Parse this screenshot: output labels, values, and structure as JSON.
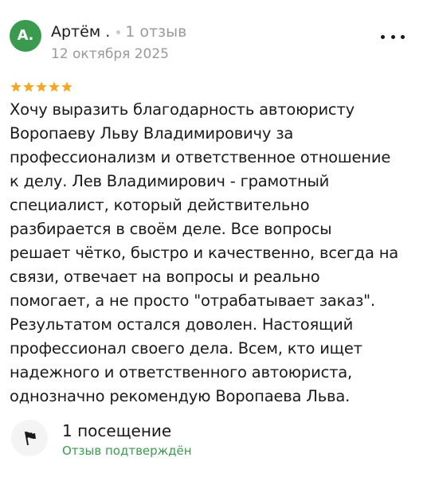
{
  "review": {
    "author": {
      "initial": "А.",
      "name": "Артём .",
      "review_count": "1 отзыв",
      "avatar_color": "#3a9b4e"
    },
    "date": "12 октября 2025",
    "rating": 5,
    "rating_max": 5,
    "star_color": "#f5a623",
    "text_lines": [
      "Хочу выразить благодарность автоюристу",
      "Воропаеву Льву Владимировичу за",
      "профессионализм и ответственное отношение",
      "к делу. Лев Владимирович - грамотный",
      "специалист, который действительно",
      "разбирается в своём деле. Все вопросы",
      "решает чётко, быстро и качественно, всегда на",
      "связи, отвечает на вопросы и реально",
      "помогает, а не просто \"отрабатывает заказ\".",
      "Результатом остался доволен. Настоящий",
      "профессионал своего дела. Всем, кто ищет",
      "надежного и ответственного автоюриста,",
      "однозначно рекомендую Воропаева Льва."
    ],
    "visits": "1 посещение",
    "verified_label": "Отзыв подтверждён",
    "verified_color": "#3a9b4e",
    "icons": {
      "more": "more-options-icon",
      "star": "star-icon",
      "visit": "flag-icon"
    }
  }
}
